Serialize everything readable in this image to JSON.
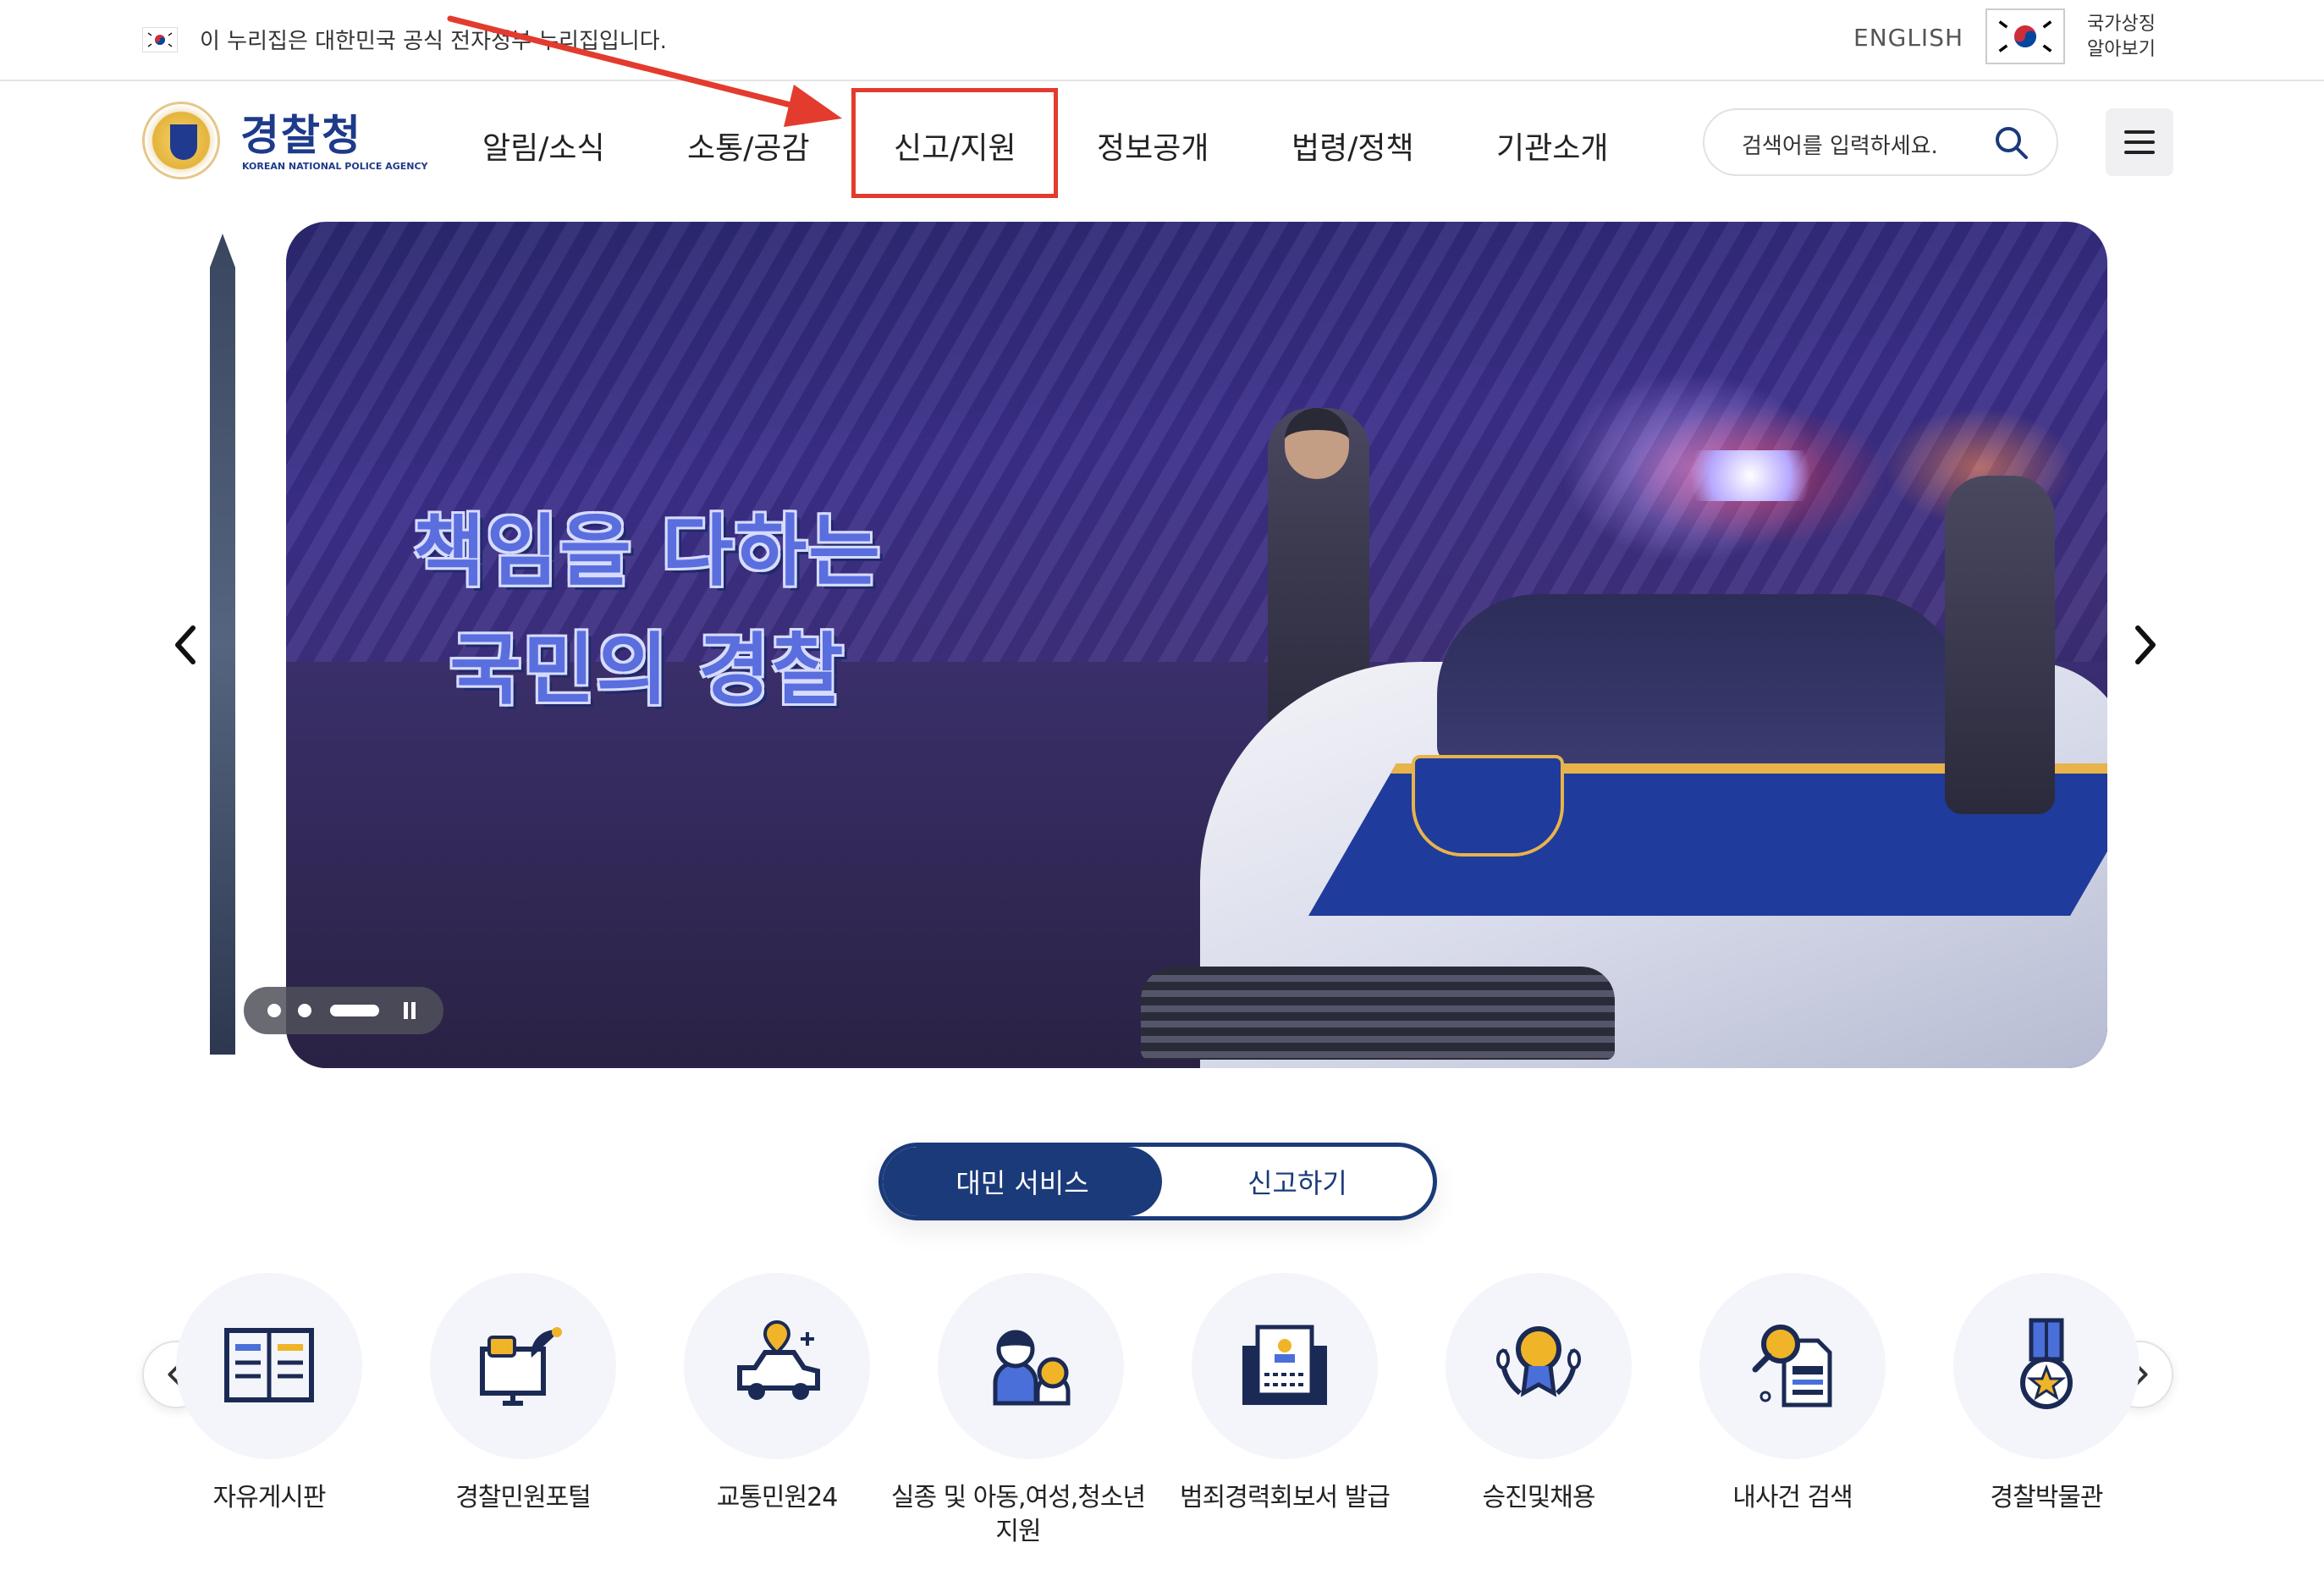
{
  "gov_banner": {
    "notice": "이 누리집은 대한민국 공식 전자정부 누리집입니다.",
    "language_link": "ENGLISH",
    "symbol_link_line1": "국가상징",
    "symbol_link_line2": "알아보기"
  },
  "header": {
    "logo_title": "경찰청",
    "logo_subtitle": "KOREAN NATIONAL POLICE AGENCY",
    "nav": [
      "알림/소식",
      "소통/공감",
      "신고/지원",
      "정보공개",
      "법령/정책",
      "기관소개"
    ],
    "highlighted_nav": "신고/지원",
    "search_placeholder": "검색어를 입력하세요."
  },
  "hero": {
    "headline_line1": "책임을 다하는",
    "headline_line2": "국민의 경찰",
    "slide_count": 3,
    "active_slide": 3
  },
  "service_tabs": {
    "active": "대민 서비스",
    "inactive": "신고하기"
  },
  "services": [
    {
      "label": "자유게시판",
      "icon": "board-icon"
    },
    {
      "label": "경찰민원포털",
      "icon": "civil-portal-icon"
    },
    {
      "label": "교통민원24",
      "icon": "traffic-icon"
    },
    {
      "label": "실종 및 아동,여성,청소년 지원",
      "icon": "family-icon"
    },
    {
      "label": "범죄경력회보서 발급",
      "icon": "certificate-icon"
    },
    {
      "label": "승진및채용",
      "icon": "award-icon"
    },
    {
      "label": "내사건 검색",
      "icon": "case-search-icon"
    },
    {
      "label": "경찰박물관",
      "icon": "museum-medal-icon"
    }
  ],
  "colors": {
    "brand_navy": "#1b3a7a",
    "annotation_red": "#e33b2e",
    "icon_gold": "#f0b429"
  }
}
